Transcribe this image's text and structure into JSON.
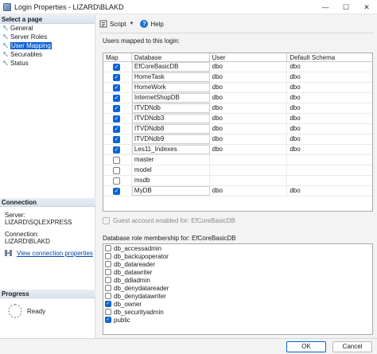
{
  "window": {
    "title": "Login Properties - LIZARD\\BLAKD",
    "minimize": "—",
    "maximize": "☐",
    "close": "✕"
  },
  "left": {
    "select_page_header": "Select a page",
    "pages": [
      {
        "label": "General",
        "selected": false
      },
      {
        "label": "Server Roles",
        "selected": false
      },
      {
        "label": "User Mapping",
        "selected": true
      },
      {
        "label": "Securables",
        "selected": false
      },
      {
        "label": "Status",
        "selected": false
      }
    ],
    "connection_header": "Connection",
    "server_label": "Server:",
    "server_value": "LIZARD\\SQLEXPRESS",
    "connection_label": "Connection:",
    "connection_value": "LIZARD\\BLAKD",
    "view_connection_link": "View connection properties",
    "progress_header": "Progress",
    "progress_status": "Ready"
  },
  "toolbar": {
    "script_label": "Script",
    "help_label": "Help"
  },
  "mapping": {
    "group_label": "Users mapped to this login:",
    "columns": [
      "Map",
      "Database",
      "User",
      "Default Schema"
    ],
    "rows": [
      {
        "checked": true,
        "database": "EfCoreBasicDB",
        "user": "dbo",
        "schema": "dbo"
      },
      {
        "checked": true,
        "database": "HomeTask",
        "user": "dbo",
        "schema": "dbo"
      },
      {
        "checked": true,
        "database": "HomeWork",
        "user": "dbo",
        "schema": "dbo"
      },
      {
        "checked": true,
        "database": "InternetShopDB",
        "user": "dbo",
        "schema": "dbo"
      },
      {
        "checked": true,
        "database": "ITVDNdb",
        "user": "dbo",
        "schema": "dbo"
      },
      {
        "checked": true,
        "database": "ITVDNdb3",
        "user": "dbo",
        "schema": "dbo"
      },
      {
        "checked": true,
        "database": "ITVDNdb8",
        "user": "dbo",
        "schema": "dbo"
      },
      {
        "checked": true,
        "database": "ITVDNdb9",
        "user": "dbo",
        "schema": "dbo"
      },
      {
        "checked": true,
        "database": "Les11_Indexes",
        "user": "dbo",
        "schema": "dbo"
      },
      {
        "checked": false,
        "database": "master",
        "user": "",
        "schema": ""
      },
      {
        "checked": false,
        "database": "model",
        "user": "",
        "schema": ""
      },
      {
        "checked": false,
        "database": "msdb",
        "user": "",
        "schema": ""
      },
      {
        "checked": true,
        "database": "MyDB",
        "user": "dbo",
        "schema": "dbo"
      }
    ]
  },
  "guest_label": "Guest account enabled for: EfCoreBasicDB",
  "roles": {
    "group_label": "Database role membership for: EfCoreBasicDB",
    "items": [
      {
        "label": "db_accessadmin",
        "checked": false
      },
      {
        "label": "db_backupoperator",
        "checked": false
      },
      {
        "label": "db_datareader",
        "checked": false
      },
      {
        "label": "db_datawriter",
        "checked": false
      },
      {
        "label": "db_ddladmin",
        "checked": false
      },
      {
        "label": "db_denydatareader",
        "checked": false
      },
      {
        "label": "db_denydatawriter",
        "checked": false
      },
      {
        "label": "db_owner",
        "checked": true
      },
      {
        "label": "db_securityadmin",
        "checked": false
      },
      {
        "label": "public",
        "checked": true
      }
    ]
  },
  "footer": {
    "ok_label": "OK",
    "cancel_label": "Cancel"
  },
  "colors": {
    "accent": "#0a64d6",
    "link": "#0645ad"
  }
}
